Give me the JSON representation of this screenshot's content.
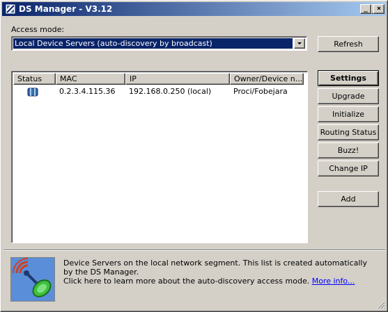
{
  "window": {
    "title": "DS Manager - V3.12"
  },
  "title_buttons": {
    "minimize": "_",
    "maximize": "□",
    "close": "×"
  },
  "access_mode": {
    "label": "Access mode:",
    "selected": "Local Device Servers (auto-discovery by broadcast)"
  },
  "buttons": {
    "refresh": "Refresh",
    "settings": "Settings",
    "upgrade": "Upgrade",
    "initialize": "Initialize",
    "routing_status": "Routing Status",
    "buzz": "Buzz!",
    "change_ip": "Change IP",
    "add": "Add"
  },
  "device_list": {
    "columns": [
      "Status",
      "MAC",
      "IP",
      "Owner/Device n..."
    ],
    "rows": [
      {
        "status_icon": "device-server-icon",
        "mac": "0.2.3.4.115.36",
        "ip": "192.168.0.250 (local)",
        "owner": "Proci/Fobejara"
      }
    ]
  },
  "info": {
    "line1": "Device Servers on the local network segment. This list is created automatically by the DS Manager.",
    "line2": "Click here to learn more about the auto-discovery access mode.",
    "link": "More info..."
  },
  "colors": {
    "face": "#d4d0c8",
    "title_start": "#0a246a",
    "title_end": "#a6caf0",
    "selection": "#0a246a",
    "link": "#0000ff"
  }
}
